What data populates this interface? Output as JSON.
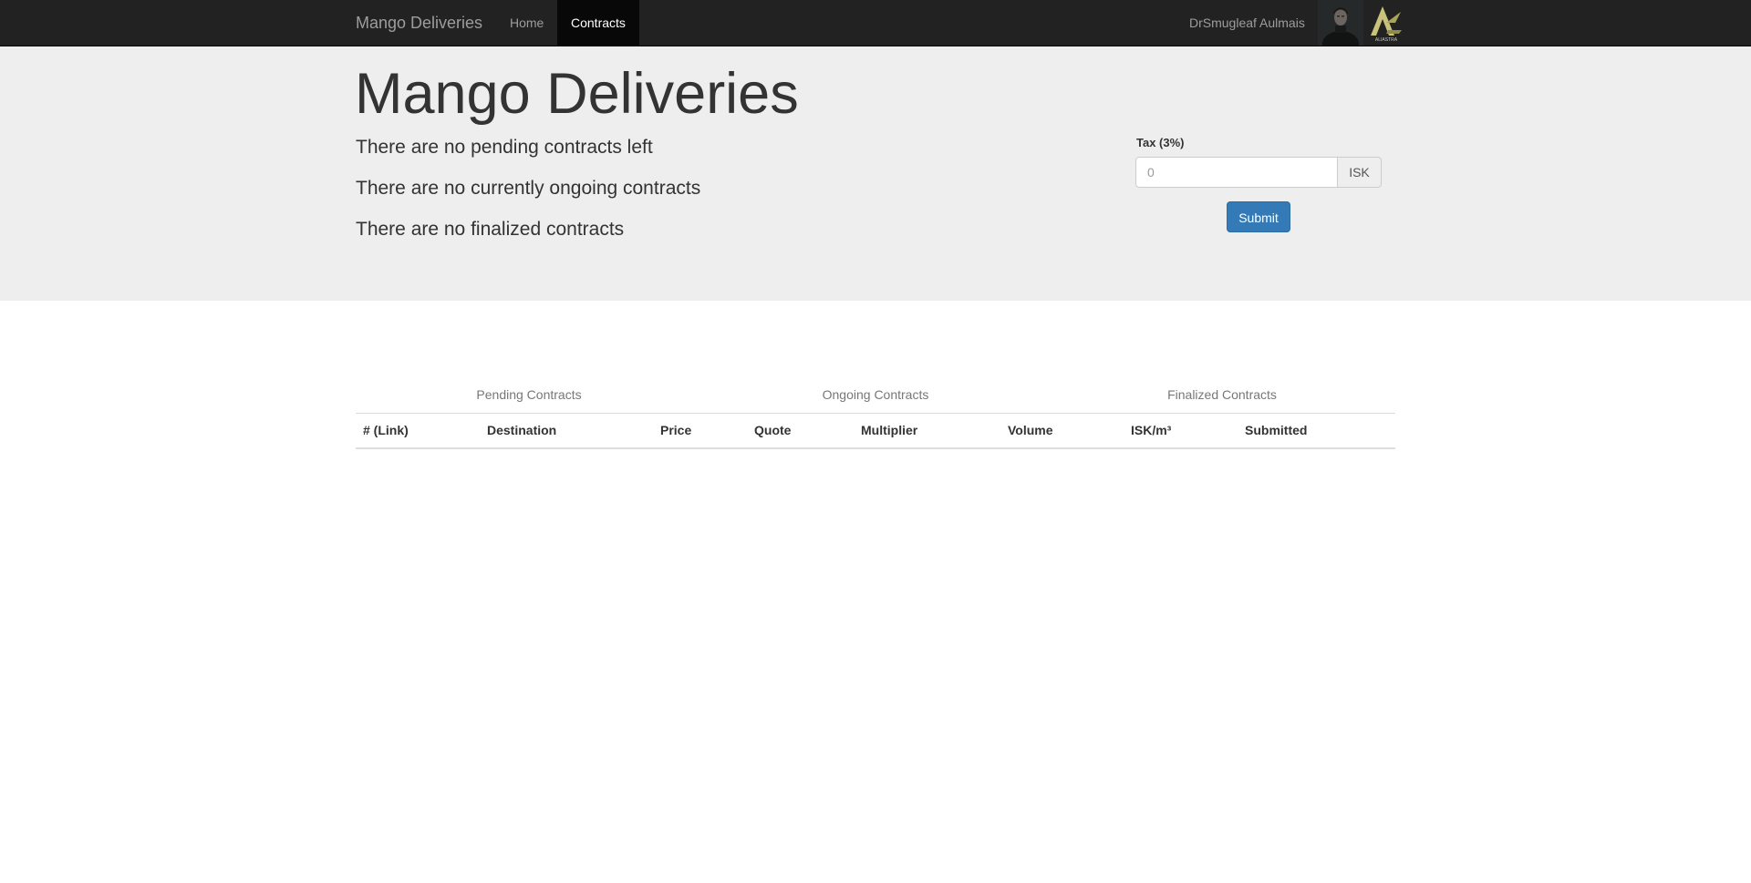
{
  "navbar": {
    "brand": "Mango Deliveries",
    "links": [
      {
        "label": "Home",
        "active": false
      },
      {
        "label": "Contracts",
        "active": true
      }
    ],
    "user_name": "DrSmugleaf Aulmais",
    "corp_logo_text": "ALIASTRA"
  },
  "main": {
    "title": "Mango Deliveries",
    "status": {
      "pending": "There are no pending contracts left",
      "ongoing": "There are no currently ongoing contracts",
      "finalized": "There are no finalized contracts"
    },
    "tax_form": {
      "label": "Tax (3%)",
      "placeholder": "0",
      "value": "",
      "addon": "ISK",
      "submit_label": "Submit"
    }
  },
  "tabs": [
    {
      "label": "Pending Contracts"
    },
    {
      "label": "Ongoing Contracts"
    },
    {
      "label": "Finalized Contracts"
    }
  ],
  "table": {
    "columns": [
      "# (Link)",
      "Destination",
      "Price",
      "Quote",
      "Multiplier",
      "Volume",
      "ISK/m³",
      "Submitted"
    ],
    "rows": []
  },
  "colors": {
    "navbar_bg": "#222222",
    "nav_active_bg": "#080808",
    "jumbotron_bg": "#eeeeee",
    "primary_button": "#337ab7",
    "corp_logo_accent": "#c8c27a"
  },
  "icons": {
    "avatar": "user-portrait",
    "corp_logo": "aliastra-logo"
  }
}
